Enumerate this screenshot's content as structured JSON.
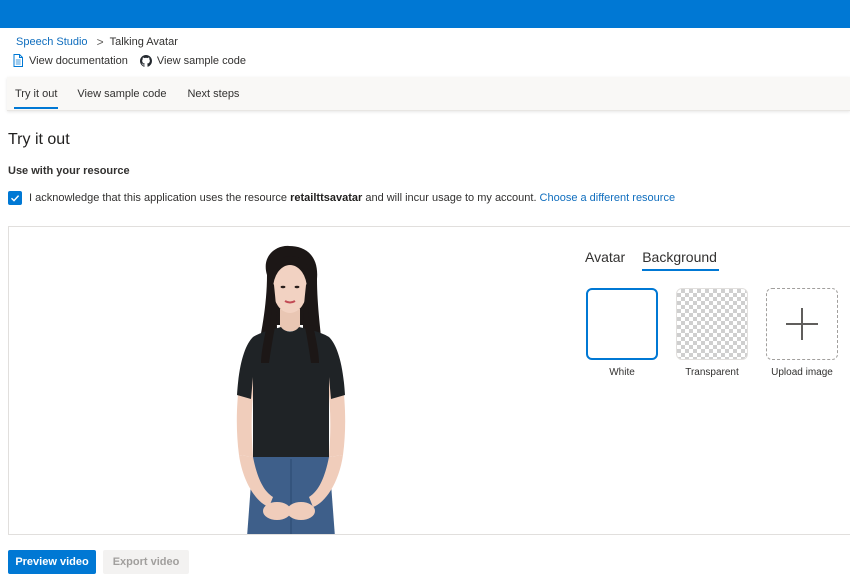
{
  "breadcrumb": {
    "root": "Speech Studio",
    "separator": ">",
    "current": "Talking Avatar"
  },
  "links": {
    "documentation": "View documentation",
    "sample_code": "View sample code"
  },
  "tabs": [
    {
      "label": "Try it out",
      "active": true
    },
    {
      "label": "View sample code",
      "active": false
    },
    {
      "label": "Next steps",
      "active": false
    }
  ],
  "page": {
    "title": "Try it out",
    "section_label": "Use with your resource",
    "ack": {
      "checked": true,
      "text_before": "I acknowledge that this application uses the resource",
      "resource": "retailttsavatar",
      "text_after": "and will incur usage to my account.",
      "link": "Choose a different resource"
    }
  },
  "panel": {
    "tabs": [
      {
        "label": "Avatar",
        "active": false
      },
      {
        "label": "Background",
        "active": true
      }
    ],
    "backgrounds": [
      {
        "label": "White",
        "selected": true
      },
      {
        "label": "Transparent",
        "selected": false
      },
      {
        "label": "Upload image",
        "selected": false
      }
    ]
  },
  "actions": {
    "preview": "Preview video",
    "export": "Export video"
  },
  "colors": {
    "accent": "#0078d4",
    "link": "#106ebe"
  }
}
